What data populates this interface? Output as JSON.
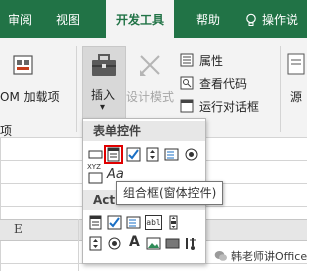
{
  "ribbon_tabs": [
    {
      "label": "审阅",
      "active": false
    },
    {
      "label": "视图",
      "active": false
    },
    {
      "label": "开发工具",
      "active": true
    },
    {
      "label": "帮助",
      "active": false
    },
    {
      "label": "操作说",
      "active": false
    }
  ],
  "ribbon": {
    "com_addins_label": "OM 加载项",
    "group_partial_label": "项",
    "insert_label": "插入",
    "insert_dropdown_arrow": "▾",
    "design_mode_label": "设计模式",
    "properties_label": "属性",
    "view_code_label": "查看代码",
    "run_dialog_label": "运行对话框",
    "source_partial_label": "源"
  },
  "dropdown": {
    "form_controls_title": "表单控件",
    "activex_title_partial": "Act",
    "form_control_icons": [
      "button-icon",
      "combo-box-icon",
      "checkbox-icon",
      "spin-button-icon",
      "list-box-icon",
      "option-button-icon",
      "group-box-icon",
      "label-icon"
    ],
    "aa_text": "Aa",
    "xyz_text": "XYZ",
    "activex_icons": [
      "combo-box-icon",
      "checkbox-icon",
      "list-box-icon",
      "textbox-icon",
      "scroll-bar-icon",
      "spin-button-icon",
      "option-button-icon",
      "label-icon",
      "image-icon",
      "toggle-button-icon",
      "more-controls-icon"
    ],
    "activex_label_text": "A",
    "activex_textbox_text": "abl"
  },
  "tooltip": {
    "text": "组合框(窗体控件)"
  },
  "sheet": {
    "column_label": "E"
  },
  "watermark": {
    "text": "韩老师讲Office"
  },
  "colors": {
    "accent": "#217346",
    "highlight": "#e00000"
  }
}
